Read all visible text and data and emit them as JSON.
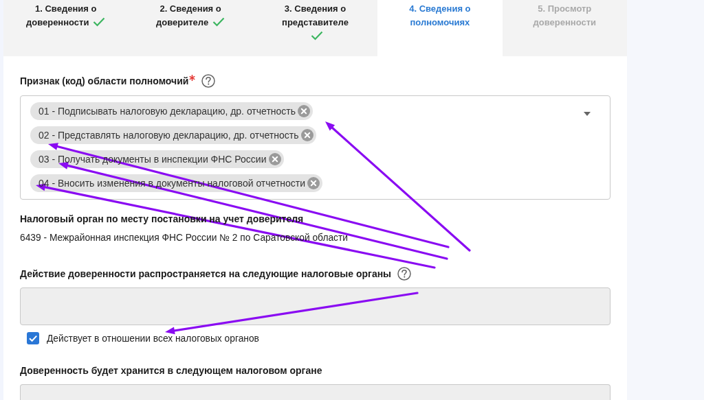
{
  "steps": [
    {
      "label": "1. Сведения о доверенности",
      "completed": true,
      "selected": false,
      "disabled": false
    },
    {
      "label": "2. Сведения о доверителе",
      "completed": true,
      "selected": false,
      "disabled": false
    },
    {
      "label": "3. Сведения о представителе",
      "completed": true,
      "selected": false,
      "disabled": false
    },
    {
      "label": "4. Сведения о полномочиях",
      "completed": false,
      "selected": true,
      "disabled": false
    },
    {
      "label": "5. Просмотр доверенности",
      "completed": false,
      "selected": false,
      "disabled": true
    }
  ],
  "authority_codes": {
    "label": "Признак (код) области полномочий",
    "required": true,
    "chips": [
      {
        "label": "01 - Подписывать налоговую декларацию, др. отчетность"
      },
      {
        "label": "02 - Представлять налоговую декларацию, др. отчетность"
      },
      {
        "label": "03 - Получать документы в инспекции ФНС России"
      },
      {
        "label": "04 - Вносить изменения в документы налоговой отчетности"
      }
    ]
  },
  "registration_office": {
    "label": "Налоговый орган по месту постановки на учет доверителя",
    "value": "6439 - Межрайонная инспекция ФНС России № 2 по Саратовской области"
  },
  "applies_to": {
    "label": "Действие доверенности распространяется на следующие налоговые органы",
    "field": {
      "disabled": true
    },
    "all_offices": {
      "label": "Действует в отношении всех налоговых органов",
      "checked": true
    }
  },
  "storage_office": {
    "label": "Доверенность будет хранится в следующем налоговом органе",
    "field": {
      "disabled": true
    }
  }
}
